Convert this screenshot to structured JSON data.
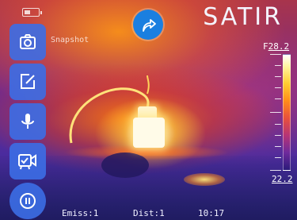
{
  "app": {
    "logo_text": "SATIR",
    "snapshot_label": "Snapshot"
  },
  "status": {
    "battery_icon": "battery-low-icon",
    "share_icon": "share-arrow-icon"
  },
  "toolbar": {
    "items": [
      {
        "name": "camera",
        "icon": "camera-icon"
      },
      {
        "name": "edit",
        "icon": "edit-note-icon"
      },
      {
        "name": "microphone",
        "icon": "microphone-icon"
      },
      {
        "name": "video",
        "icon": "video-check-icon"
      },
      {
        "name": "pause",
        "icon": "pause-icon"
      }
    ]
  },
  "scale": {
    "unit": "F",
    "max": "28.2",
    "min": "22.2",
    "palette": [
      "#ffffff",
      "#fff5a0",
      "#ffcd30",
      "#ff8c1a",
      "#e8503c",
      "#b63476",
      "#6e2a9c",
      "#2a1a7a"
    ]
  },
  "footer": {
    "emissivity": "Emiss:1",
    "distance": "Dist:1",
    "time": "10:17"
  },
  "colors": {
    "accent": "#1a7fe0",
    "toolbar": "#3c6ee6"
  }
}
